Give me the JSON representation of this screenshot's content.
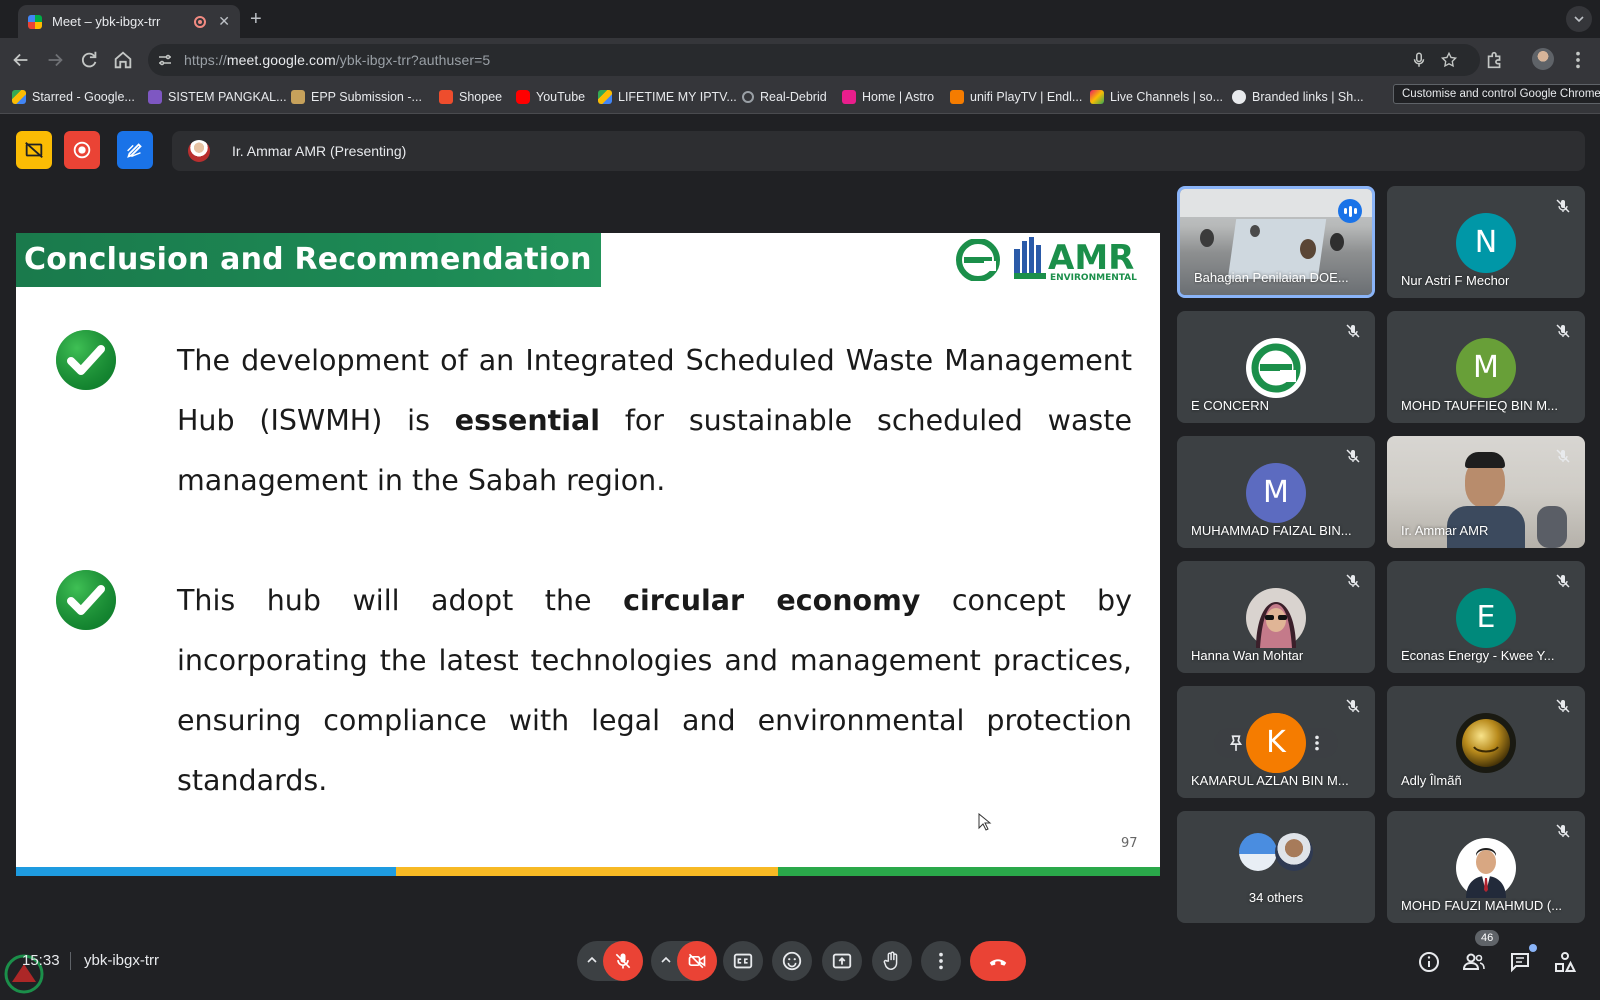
{
  "browser": {
    "tab_title": "Meet – ybk-ibgx-trr",
    "url_prefix": "https://",
    "url_host": "meet.google.com",
    "url_path": "/ybk-ibgx-trr?authuser=5",
    "tooltip": "Customise and control Google Chrome",
    "bookmarks": [
      {
        "label": "Starred - Google...",
        "color": "#fbbc04"
      },
      {
        "label": "SISTEM PANGKAL...",
        "color": "#7e57c2"
      },
      {
        "label": "EPP Submission -...",
        "color": "#c6a15b"
      },
      {
        "label": "Shopee",
        "color": "#ee4d2d"
      },
      {
        "label": "YouTube",
        "color": "#ff0000"
      },
      {
        "label": "LIFETIME MY IPTV...",
        "color": "#34a853"
      },
      {
        "label": "Real-Debrid",
        "color": "#9aa0a6"
      },
      {
        "label": "Home | Astro",
        "color": "#e91e8c"
      },
      {
        "label": "unifi PlayTV | Endl...",
        "color": "#f57c00"
      },
      {
        "label": "Live Channels | so...",
        "color": "#e91e63"
      },
      {
        "label": "Branded links | Sh...",
        "color": "#e8eaed"
      }
    ]
  },
  "meet": {
    "presenter_label": "Ir. Ammar AMR (Presenting)",
    "clock": "15:33",
    "meeting_code": "ybk-ibgx-trr",
    "people_count": "46",
    "accent_red": "#ea4335",
    "accent_blue": "#1a73e8"
  },
  "slide": {
    "title": "Conclusion and Recommendation",
    "logo_text": "AMR",
    "logo_sub": "ENVIRONMENTAL",
    "bullet1": {
      "before": "The development of an Integrated Scheduled Waste Management Hub (ISWMH) is ",
      "bold": "essential",
      "after": " for sustainable scheduled waste management in the Sabah region."
    },
    "bullet2": {
      "before": "This hub will adopt the ",
      "bold": "circular economy",
      "after": " concept by incorporating the latest technologies and management practices, ensuring compliance with legal and environmental protection standards."
    },
    "page_number": "97",
    "stripe_colors": [
      "#1e9be0",
      "#f7b924",
      "#2aa84a"
    ]
  },
  "participants": [
    {
      "name": "Bahagian Penilaian DOE...",
      "type": "video-room",
      "muted": false,
      "speaking": true
    },
    {
      "name": "Nur Astri F Mechor",
      "initial": "N",
      "color": "#0097a7",
      "muted": true
    },
    {
      "name": "E CONCERN",
      "type": "logo-e",
      "muted": true
    },
    {
      "name": "MOHD TAUFFIEQ BIN M...",
      "initial": "M",
      "color": "#689f38",
      "muted": true
    },
    {
      "name": "MUHAMMAD FAIZAL BIN...",
      "initial": "M",
      "color": "#5c6bc0",
      "muted": true
    },
    {
      "name": "Ir. Ammar AMR",
      "type": "video-person",
      "muted": true
    },
    {
      "name": "Hanna Wan Mohtar",
      "type": "photo-hijab",
      "muted": true
    },
    {
      "name": "Econas Energy - Kwee Y...",
      "initial": "E",
      "color": "#00897b",
      "muted": true
    },
    {
      "name": "KAMARUL AZLAN BIN M...",
      "initial": "K",
      "color": "#f57c00",
      "muted": true
    },
    {
      "name": "Adly Îlmãñ",
      "type": "photo-gold",
      "muted": true
    },
    {
      "name": "34 others",
      "type": "others"
    },
    {
      "name": "MOHD FAUZI MAHMUD (...",
      "type": "photo-suit",
      "muted": true
    }
  ]
}
